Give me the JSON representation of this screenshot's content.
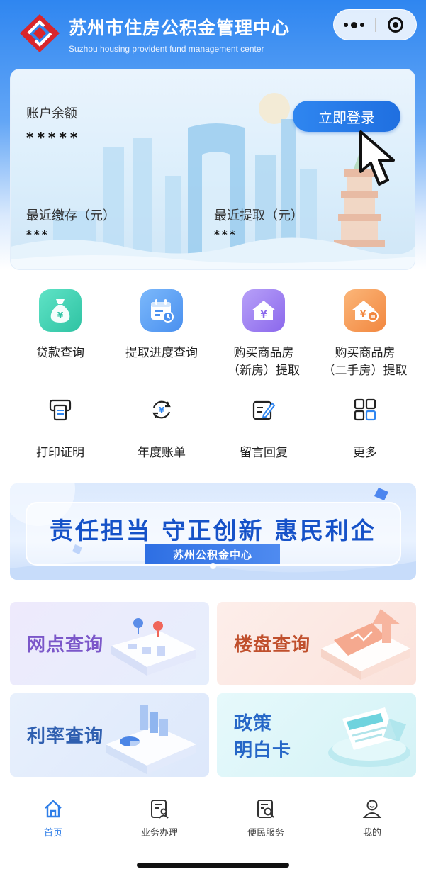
{
  "header": {
    "title": "苏州市住房公积金管理中心",
    "subtitle": "Suzhou housing provident fund management center",
    "capsule": {
      "more_icon": "more-dots-icon",
      "close_icon": "target-close-icon"
    }
  },
  "account": {
    "balance_label": "账户余额",
    "balance_value": "*****",
    "login_label": "立即登录",
    "deposit_label": "最近缴存（元）",
    "deposit_value": "***",
    "withdraw_label": "最近提取（元）",
    "withdraw_value": "***"
  },
  "services": [
    {
      "label": "贷款查询",
      "icon": "money-bag-icon",
      "color": "#3dd2b0"
    },
    {
      "label": "提取进度查询",
      "icon": "calendar-clock-icon",
      "color": "#5aa2f5"
    },
    {
      "label": "购买商品房（新房）提取",
      "line1": "购买商品房",
      "line2": "（新房）提取",
      "icon": "house-yuan-icon",
      "color": "#9a7cf0"
    },
    {
      "label": "购买商品房（二手房）提取",
      "line1": "购买商品房",
      "line2": "（二手房）提取",
      "icon": "house-exchange-icon",
      "color": "#f59a5a"
    }
  ],
  "services2": [
    {
      "label": "打印证明",
      "icon": "printer-icon"
    },
    {
      "label": "年度账单",
      "icon": "yuan-refresh-icon"
    },
    {
      "label": "留言回复",
      "icon": "edit-note-icon"
    },
    {
      "label": "更多",
      "icon": "grid-more-icon"
    }
  ],
  "banner": {
    "slogan": "责任担当 守正创新 惠民利企",
    "tag": "苏州公积金中心"
  },
  "tiles": [
    {
      "label": "网点查询",
      "color": "#7b57c9"
    },
    {
      "label": "楼盘查询",
      "color": "#c0502d"
    },
    {
      "label": "利率查询",
      "color": "#2f5fb0"
    },
    {
      "line1": "政策",
      "line2": "明白卡",
      "color": "#2667c7"
    }
  ],
  "tabbar": [
    {
      "label": "首页",
      "icon": "home-icon",
      "active": true
    },
    {
      "label": "业务办理",
      "icon": "document-user-icon",
      "active": false
    },
    {
      "label": "便民服务",
      "icon": "document-search-icon",
      "active": false
    },
    {
      "label": "我的",
      "icon": "user-icon",
      "active": false
    }
  ],
  "colors": {
    "primary": "#2f86f0",
    "active_tab": "#2f7ee8"
  }
}
